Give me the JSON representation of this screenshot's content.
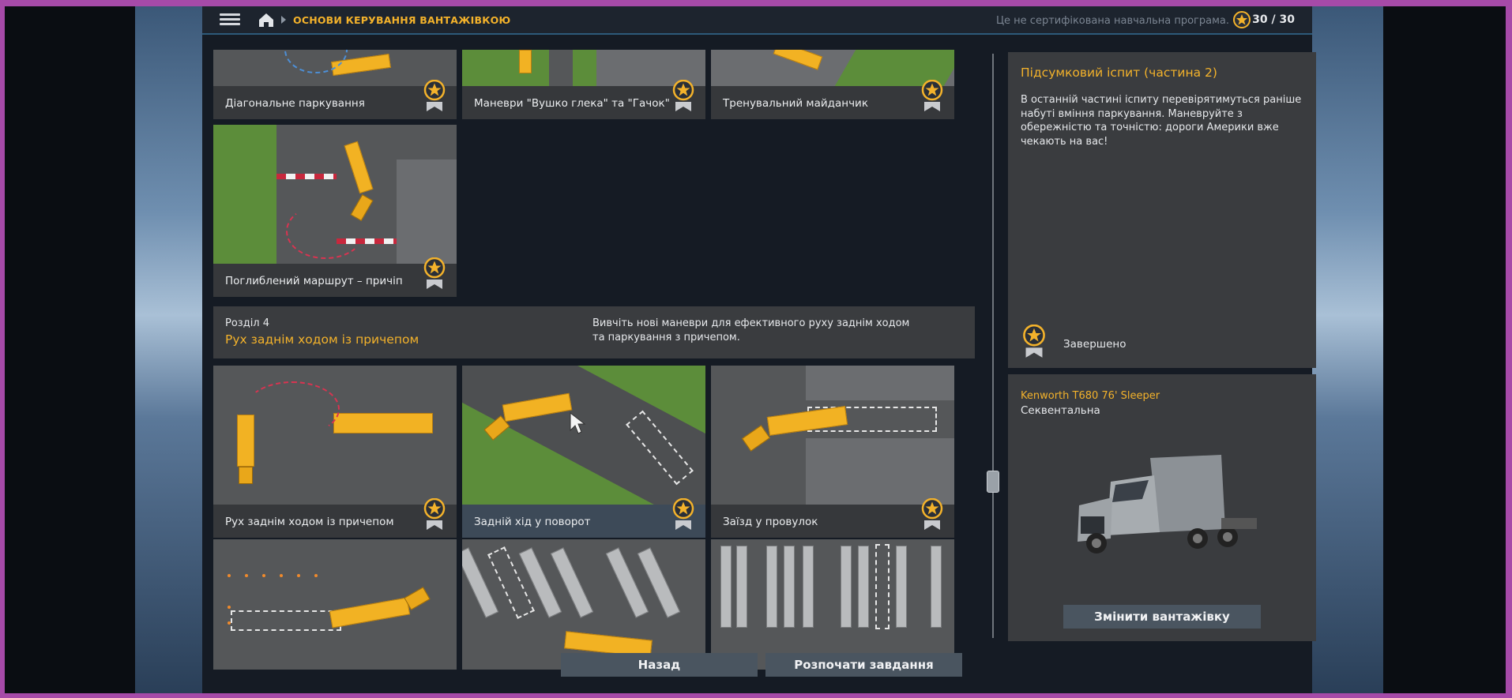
{
  "topbar": {
    "breadcrumb": "ОСНОВИ КЕРУВАННЯ ВАНТАЖІВКОЮ",
    "certification_note": "Це не сертифікована навчальна програма.",
    "score": "30 / 30"
  },
  "cards_top": [
    {
      "title": "Діагональне паркування"
    },
    {
      "title": "Маневри \"Вушко глека\" та \"Гачок\""
    },
    {
      "title": "Тренувальний майданчик"
    }
  ],
  "card_deep": {
    "title": "Поглиблений маршрут – причіп"
  },
  "section4": {
    "number": "Розділ 4",
    "title": "Рух заднім ходом із причепом",
    "description": "Вивчіть нові маневри для ефективного руху заднім ходом та паркування з причепом."
  },
  "cards_section4": [
    {
      "title": "Рух заднім ходом із причепом"
    },
    {
      "title": "Задній хід у поворот"
    },
    {
      "title": "Заїзд у провулок"
    }
  ],
  "exam": {
    "title": "Підсумковий іспит (частина 2)",
    "description": "В останній частині іспиту перевірятимуться раніше набуті вміння паркування. Маневруйте з обережністю та точністю: дороги Америки вже чекають на вас!",
    "status": "Завершено"
  },
  "vehicle": {
    "name": "Kenworth T680 76' Sleeper",
    "transmission": "Секвентальна",
    "change_label": "Змінити вантажівку"
  },
  "buttons": {
    "back": "Назад",
    "start": "Розпочати завдання"
  },
  "colors": {
    "accent": "#f3b22b",
    "button": "#4a5560",
    "panel": "#3a3c3f"
  }
}
